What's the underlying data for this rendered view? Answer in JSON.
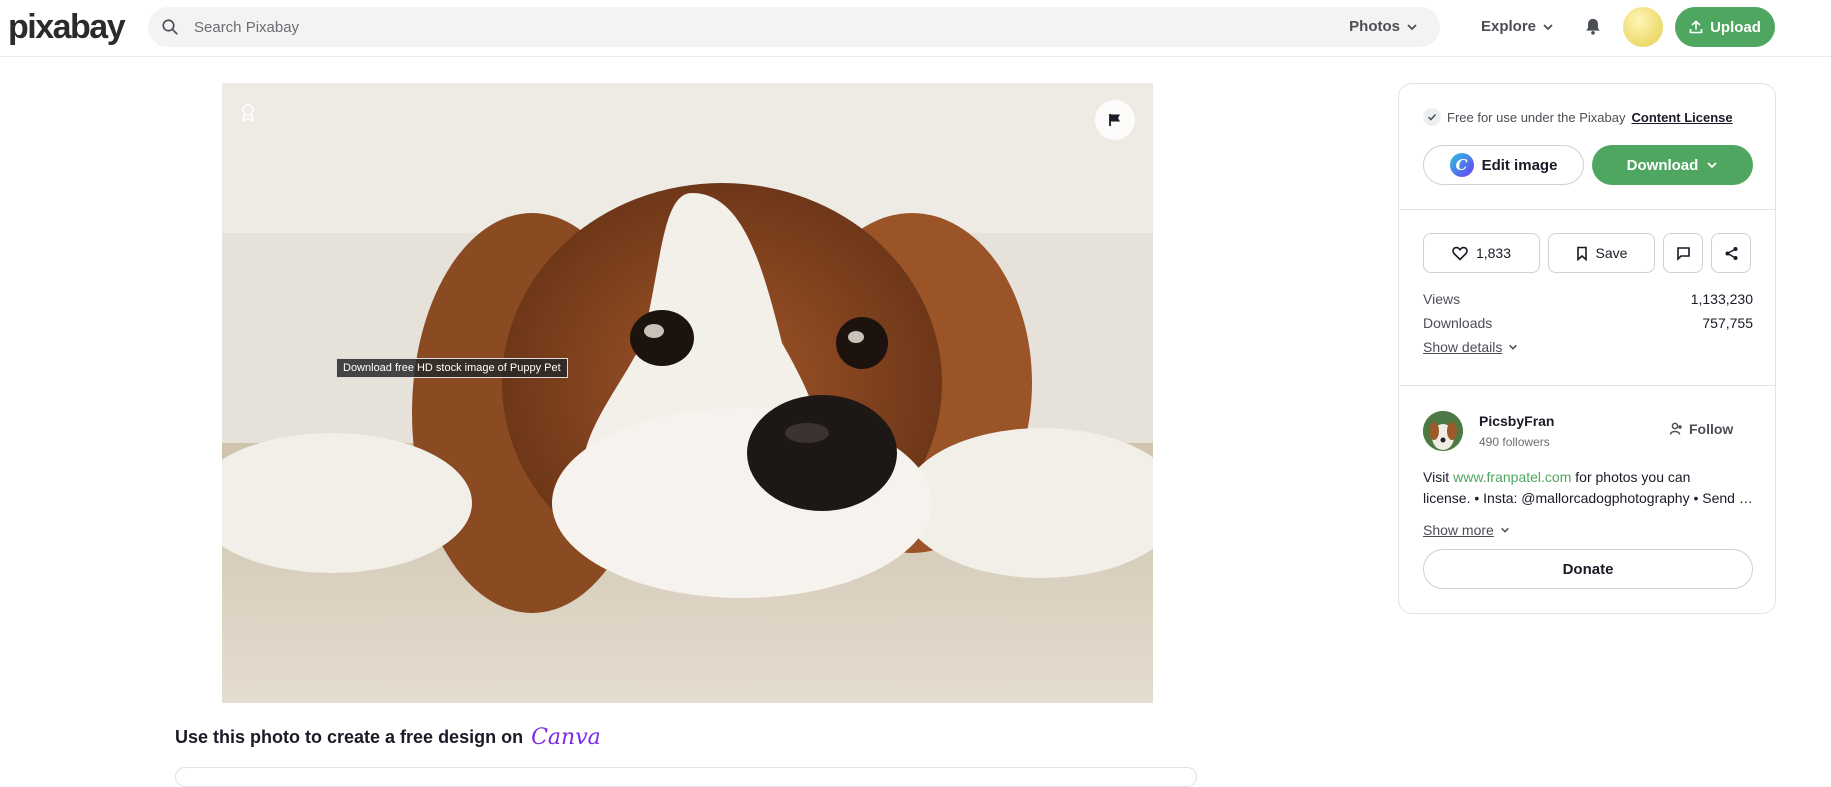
{
  "header": {
    "logo": "pixabay",
    "search_placeholder": "Search Pixabay",
    "media_type": "Photos",
    "explore_label": "Explore",
    "upload_label": "Upload"
  },
  "photo": {
    "alt_tooltip": "Download free HD stock image of Puppy Pet"
  },
  "canva_prompt": {
    "text": "Use this photo to create a free design on",
    "brand": "Canva"
  },
  "sidebar": {
    "license_text": "Free for use under the Pixabay",
    "license_link": "Content License",
    "edit_label": "Edit image",
    "download_label": "Download",
    "likes": "1,833",
    "save_label": "Save",
    "stats": [
      {
        "label": "Views",
        "value": "1,133,230"
      },
      {
        "label": "Downloads",
        "value": "757,755"
      }
    ],
    "show_details": "Show details",
    "user": {
      "name": "PicsbyFran",
      "followers": "490 followers",
      "follow_label": "Follow",
      "bio_prefix": "Visit",
      "bio_link": "www.franpatel.com",
      "bio_suffix": "for photos you can",
      "bio_line2": "license. • Insta: @mallorcadogphotography • Send me a message"
    },
    "show_more": "Show more",
    "donate_label": "Donate"
  },
  "colors": {
    "accent_green": "#4fa661",
    "text_dark": "#191b26"
  }
}
